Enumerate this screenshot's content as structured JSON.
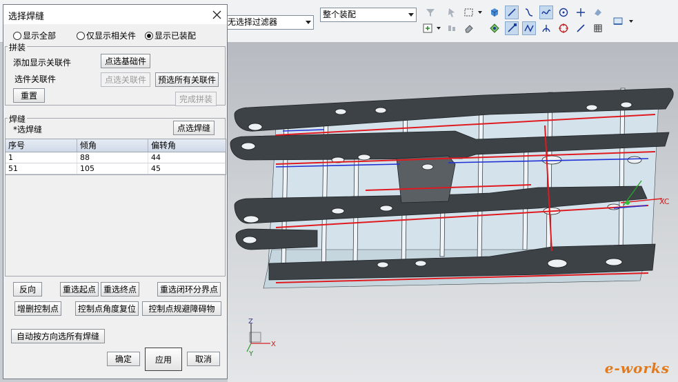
{
  "toolbar": {
    "filter_combo": "无选择过滤器",
    "assembly_combo": "整个装配"
  },
  "dialog": {
    "title": "选择焊缝",
    "display_options": [
      {
        "label": "显示全部",
        "checked": false
      },
      {
        "label": "仅显示相关件",
        "checked": false
      },
      {
        "label": "显示已装配",
        "checked": true
      }
    ],
    "assembly_group": {
      "label": "拼装",
      "add_related_label": "添加显示关联件",
      "pick_base_button": "点选基础件",
      "select_related_label": "选件关联件",
      "pick_related_button": "点选关联件",
      "preselect_all_button": "预选所有关联件",
      "reset_button": "重置",
      "finish_button": "完成拼装"
    },
    "weld_group": {
      "label": "焊缝",
      "select_weld_label": "*选焊缝",
      "pick_weld_button": "点选焊缝",
      "table": {
        "headers": [
          "序号",
          "倾角",
          "偏转角"
        ],
        "rows": [
          [
            "1",
            "88",
            "44"
          ],
          [
            "51",
            "105",
            "45"
          ]
        ]
      }
    },
    "actions": {
      "reverse": "反向",
      "reselect_start": "重选起点",
      "reselect_end": "重选终点",
      "reselect_loop": "重选闭环分界点",
      "edit_control_points": "增删控制点",
      "reset_angle": "控制点角度复位",
      "avoid_obstacle": "控制点规避障碍物",
      "auto_select_all": "自动按方向选所有焊缝"
    },
    "footer": {
      "ok": "确定",
      "apply": "应用",
      "cancel": "取消"
    }
  },
  "viewport": {
    "axis_labels": {
      "z": "Z",
      "x": "X",
      "y": "Y",
      "xc": "XC"
    },
    "watermark": "e-works"
  },
  "colors": {
    "model_face": "#d4e3eb",
    "model_dark": "#3d4247",
    "weld_red": "#e0191e",
    "edge_blue": "#1f2fd6"
  }
}
